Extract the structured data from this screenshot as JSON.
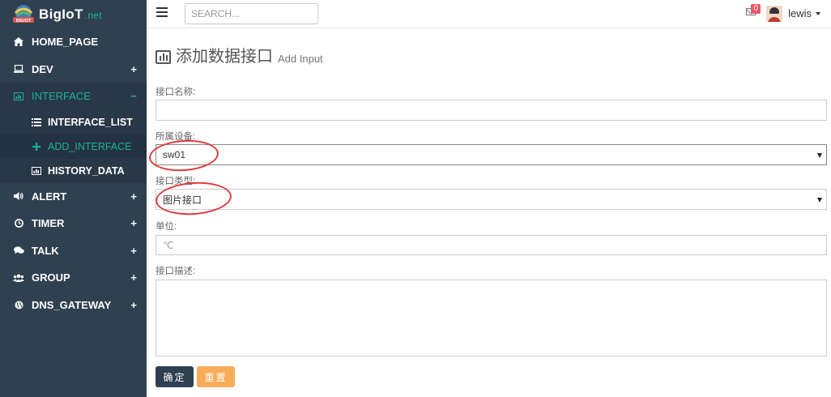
{
  "brand": {
    "name": "BigIoT",
    "suffix": ".net",
    "logo_text": "BIGIOT"
  },
  "sidebar": {
    "items": [
      {
        "label": "HOME_PAGE",
        "icon": "home-icon",
        "toggle": ""
      },
      {
        "label": "DEV",
        "icon": "laptop-icon",
        "toggle": "+"
      },
      {
        "label": "INTERFACE",
        "icon": "chart-icon",
        "toggle": "−"
      },
      {
        "label": "ALERT",
        "icon": "volume-icon",
        "toggle": "+"
      },
      {
        "label": "TIMER",
        "icon": "clock-icon",
        "toggle": "+"
      },
      {
        "label": "TALK",
        "icon": "comments-icon",
        "toggle": "+"
      },
      {
        "label": "GROUP",
        "icon": "users-icon",
        "toggle": "+"
      },
      {
        "label": "DNS_GATEWAY",
        "icon": "globe-icon",
        "toggle": "+"
      }
    ],
    "subitems": [
      {
        "label": "INTERFACE_LIST",
        "icon": "list-icon"
      },
      {
        "label": "ADD_INTERFACE",
        "icon": "plus-icon"
      },
      {
        "label": "HISTORY_DATA",
        "icon": "bar-chart-icon"
      }
    ]
  },
  "topbar": {
    "search_placeholder": "SEARCH...",
    "mail_badge": "0",
    "username": "lewis"
  },
  "page": {
    "title": "添加数据接口",
    "subtitle": "Add Input"
  },
  "form": {
    "name_label": "接口名称:",
    "name_value": "",
    "device_label": "所属设备:",
    "device_value": "sw01",
    "type_label": "接口类型:",
    "type_value": "图片接口",
    "unit_label": "单位:",
    "unit_placeholder": "℃",
    "desc_label": "接口描述:",
    "desc_value": "",
    "submit_label": "确定",
    "reset_label": "重置"
  },
  "colors": {
    "sidebar_bg": "#2f4050",
    "accent": "#1ab394",
    "submit_bg": "#2f4050",
    "reset_bg": "#f8ac59",
    "badge_bg": "#ed5565",
    "annotation": "#e03b3b"
  }
}
